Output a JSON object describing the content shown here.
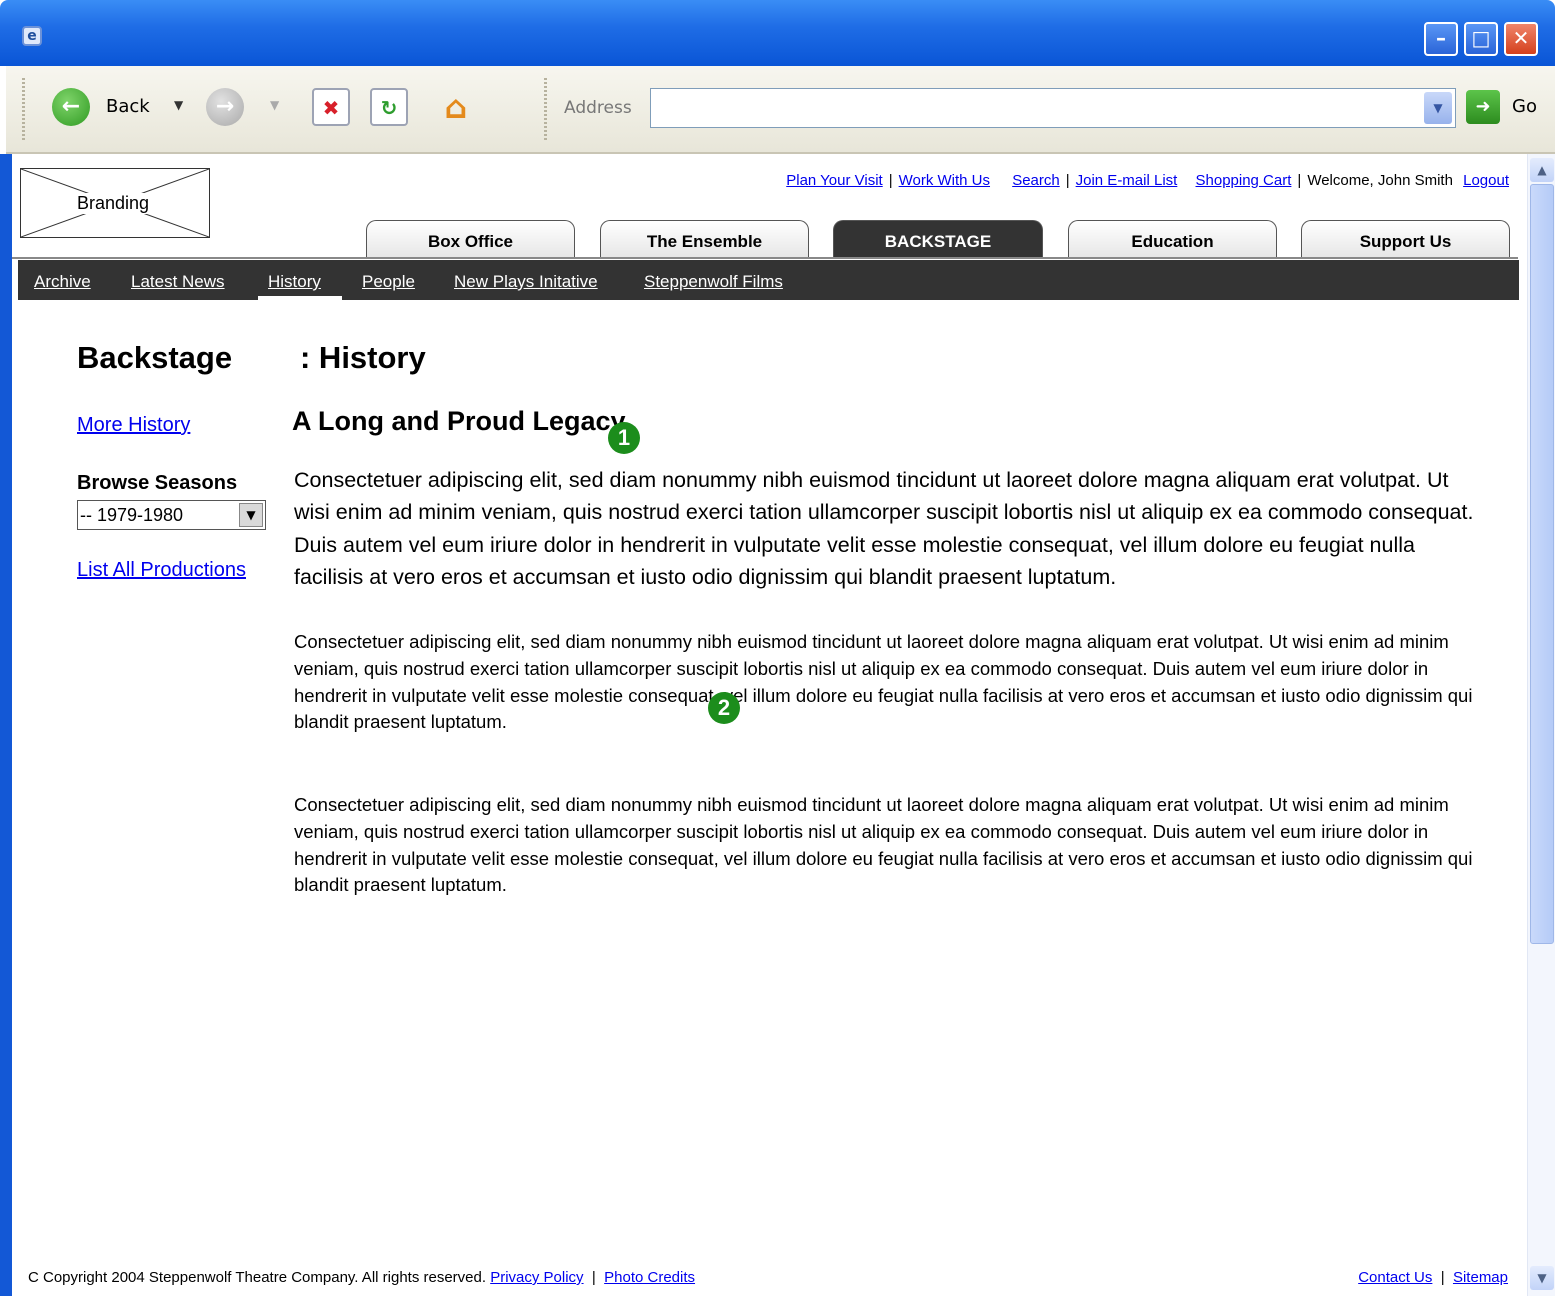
{
  "browser": {
    "back_label": "Back",
    "go_label": "Go",
    "address_label": "Address",
    "address_value": ""
  },
  "header": {
    "branding": "Branding",
    "utility": {
      "plan_visit": "Plan Your Visit",
      "work_with_us": "Work With Us",
      "search": "Search",
      "join_email": "Join E-mail List",
      "shopping_cart": "Shopping Cart",
      "welcome": "Welcome, John Smith",
      "logout": "Logout"
    },
    "tabs": [
      "Box Office",
      "The Ensemble",
      "BACKSTAGE",
      "Education",
      "Support Us"
    ],
    "active_tab": "BACKSTAGE"
  },
  "subnav": {
    "items": [
      "Archive",
      "Latest News",
      "History",
      "People",
      "New Plays Initative",
      "Steppenwolf Films"
    ],
    "current": "History"
  },
  "page": {
    "section_title": "Backstage",
    "page_title": ": History"
  },
  "sidebar": {
    "more_history": "More History",
    "browse_label": "Browse Seasons",
    "season_value": "-- 1979-1980",
    "list_all": "List All Productions"
  },
  "article": {
    "title": "A Long and Proud Legacy",
    "lead": "Consectetuer adipiscing elit, sed diam nonummy nibh euismod tincidunt ut laoreet dolore magna aliquam erat volutpat. Ut wisi enim ad minim veniam, quis nostrud exerci tation ullamcorper suscipit lobortis nisl ut aliquip ex ea commodo consequat. Duis autem vel eum iriure dolor in hendrerit in vulputate velit esse molestie consequat, vel illum dolore eu feugiat nulla facilisis at vero eros et accumsan et iusto odio dignissim qui blandit praesent luptatum.",
    "paragraph_2": "Consectetuer adipiscing elit, sed diam nonummy nibh euismod tincidunt ut laoreet dolore magna aliquam erat volutpat. Ut wisi enim ad minim veniam, quis nostrud exerci tation ullamcorper suscipit lobortis nisl ut aliquip ex ea commodo consequat. Duis autem vel eum iriure dolor in hendrerit in vulputate velit esse molestie consequat, vel illum dolore eu feugiat nulla facilisis at vero eros et accumsan et iusto odio dignissim qui blandit praesent luptatum.",
    "paragraph_3": "Consectetuer adipiscing elit, sed diam nonummy nibh euismod tincidunt ut laoreet dolore magna aliquam erat volutpat. Ut wisi enim ad minim veniam, quis nostrud exerci tation ullamcorper suscipit lobortis nisl ut aliquip ex ea commodo consequat. Duis autem vel eum iriure dolor in hendrerit in vulputate velit esse molestie consequat, vel illum dolore eu feugiat nulla facilisis at vero eros et accumsan et iusto odio dignissim qui blandit praesent luptatum."
  },
  "annotations": [
    "1",
    "2"
  ],
  "footer": {
    "copyright": "C Copyright 2004 Steppenwolf Theatre Company. All rights reserved.",
    "privacy": "Privacy Policy",
    "photo_credits": "Photo Credits",
    "contact": "Contact Us",
    "sitemap": "Sitemap"
  },
  "colors": {
    "nav_background": "#333333",
    "link": "#0000ee",
    "annotation_marker": "#1c8d1c",
    "xp_titlebar": "#0a55d6"
  }
}
